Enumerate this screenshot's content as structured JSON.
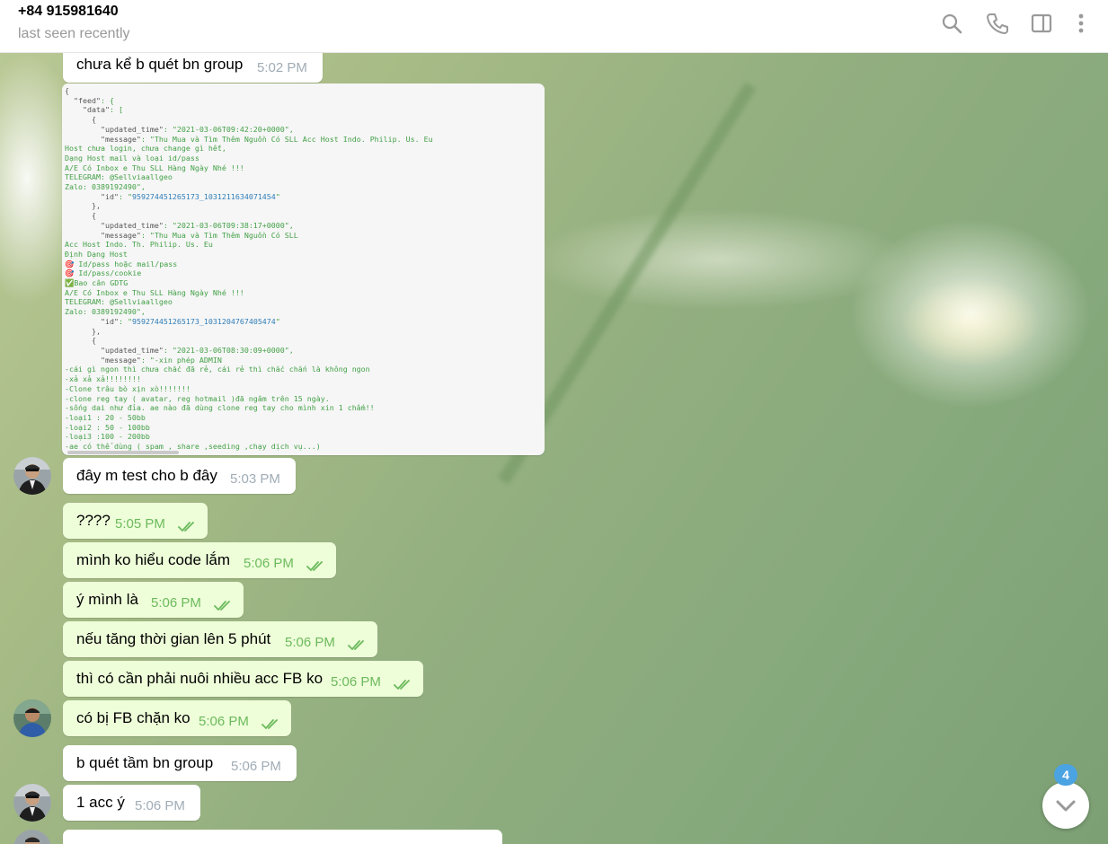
{
  "header": {
    "peer_name": "+84 915981640",
    "peer_status": "last seen recently",
    "icons": [
      "search-icon",
      "phone-icon",
      "sidebar-toggle-icon",
      "more-menu-icon"
    ]
  },
  "code_snippet": {
    "lines": [
      "{",
      "  \"feed\": {",
      "    \"data\": [",
      "      {",
      "        \"updated_time\": \"2021-03-06T09:42:20+0000\",",
      "        \"message\": \"Thu Mua và Tìm Thêm Nguồn Có SLL Acc Host Indo. Philip. Us. Eu",
      "Host chưa login, chưa change gì hết,",
      "Dạng Host mail và loại id/pass",
      "A/E Có Inbox e Thu SLL Hàng Ngày Nhé !!!",
      "TELEGRAM: @Sellviaallgeo",
      "Zalo: 0389192490\",",
      "        \"id\": \"959274451265173_1031211634071454\"",
      "      },",
      "      {",
      "        \"updated_time\": \"2021-03-06T09:38:17+0000\",",
      "        \"message\": \"Thu Mua và Tìm Thêm Nguồn Có SLL",
      "Acc Host Indo. Th. Philip. Us. Eu",
      "Định Dạng Host",
      "🎯 Id/pass hoặc mail/pass",
      "🎯 Id/pass/cookie",
      "✅Bao cân GDTG",
      "A/E Có Inbox e Thu SLL Hàng Ngày Nhé !!!",
      "TELEGRAM: @Sellviaallgeo",
      "Zalo: 0389192490\",",
      "        \"id\": \"959274451265173_1031204767405474\"",
      "      },",
      "      {",
      "        \"updated_time\": \"2021-03-06T08:30:09+0000\",",
      "        \"message\": \"-xin phép ADMIN",
      "-cái gì ngon thì chưa chắc đã rẻ, cái rẻ thì chắc chắn là không ngon",
      "-xả xả xả!!!!!!!!",
      "-Clone trâu bò xịn xò!!!!!!!",
      "-clone reg tay ( avatar, reg hotmail )đã ngâm trên 15 ngày.",
      "-sống dai như đỉa. ae nào đã dùng clone reg tay cho mình xin 1 chấm!!",
      "-loại1 : 20 - 50bb",
      "-loại2 : 50 - 100bb",
      "-loại3 :100 - 200bb",
      "-ae có thể dùng ( spam , share ,seeding ,chạy dịch vụ...)"
    ]
  },
  "messages": [
    {
      "text": "chưa kể b quét bn group",
      "time": "5:02 PM",
      "direction": "in"
    },
    {
      "text": "đây m test cho b đây",
      "time": "5:03 PM",
      "direction": "in"
    },
    {
      "text": "????",
      "time": "5:05 PM",
      "direction": "out"
    },
    {
      "text": "mình ko hiểu code lắm",
      "time": "5:06 PM",
      "direction": "out"
    },
    {
      "text": "ý mình là",
      "time": "5:06 PM",
      "direction": "out"
    },
    {
      "text": "nếu tăng thời gian lên 5 phút",
      "time": "5:06 PM",
      "direction": "out"
    },
    {
      "text": "thì có cần phải nuôi nhiều acc FB ko",
      "time": "5:06 PM",
      "direction": "out"
    },
    {
      "text": "có bị FB chặn ko",
      "time": "5:06 PM",
      "direction": "out"
    },
    {
      "text": "b quét tầm bn group",
      "time": "5:06 PM",
      "direction": "in"
    },
    {
      "text": "1 acc ý",
      "time": "5:06 PM",
      "direction": "in"
    }
  ],
  "scroll_down": {
    "unread_count": "4"
  },
  "colors": {
    "outgoing_bubble": "#eefed9",
    "incoming_bubble": "#ffffff",
    "read_check": "#6cba5d",
    "badge": "#4ba3e2"
  }
}
